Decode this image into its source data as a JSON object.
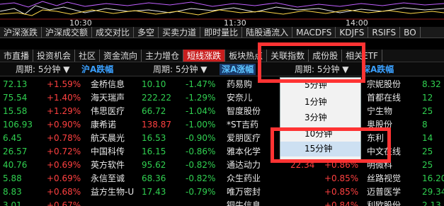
{
  "time_axis": [
    "10:30",
    "11:30",
    "14:00"
  ],
  "tabs_row1": [
    "沪深涨跌",
    "沪深成交额",
    "成交对比",
    "多空",
    "买卖力道",
    "即时量比",
    "陆股通流入",
    "MACDFS",
    "KDJFS",
    "RSIFS",
    "BO"
  ],
  "tabs_row2": [
    "市直播",
    "投资机会",
    "社区",
    "资金流向",
    "主力增仓",
    "短线涨跌",
    "板块热点",
    "关联指数",
    "成份股",
    "相关ETF"
  ],
  "active_tab_row2": "短线涨跌",
  "section_header": {
    "period_left": "周期: 5分钟 ▼",
    "title_left": "沪A跌幅",
    "period_mid": "周期: 5分钟 ▼",
    "title_mid": "深A涨幅",
    "period_right": "周期: 5分钟 ▼",
    "title_right": "深A跌幅"
  },
  "left_panel": [
    {
      "price": "72.13",
      "pct": "+1.59%"
    },
    {
      "price": "75.54",
      "pct": "+1.40%"
    },
    {
      "price": "15.58",
      "pct": "+1.29%"
    },
    {
      "price": "106.93",
      "pct": "+0.90%"
    },
    {
      "price": "6.45",
      "pct": "+0.78%"
    },
    {
      "price": "26.57",
      "pct": "+0.72%"
    },
    {
      "price": "40.76",
      "pct": "+0.69%"
    },
    {
      "price": "5.88",
      "pct": "+0.69%"
    },
    {
      "price": "8.83",
      "pct": "+0.68%"
    },
    {
      "price": "3.01",
      "pct": "+0.67%"
    }
  ],
  "mid_panel": [
    {
      "name": "金桥信息",
      "price": "10.10",
      "pct": "-1.47%"
    },
    {
      "name": "海天瑞声",
      "price": "222.22",
      "pct": "-1.29%"
    },
    {
      "name": "伟思医疗",
      "price": "66.72",
      "pct": "-1.04%"
    },
    {
      "name": "康希诺",
      "price": "138.87",
      "pct": "-1.00%"
    },
    {
      "name": "航天晨光",
      "price": "16.53",
      "pct": "-0.90%"
    },
    {
      "name": "中国科传",
      "price": "16.15",
      "pct": "-0.86%"
    },
    {
      "name": "英方软件",
      "price": "95.62",
      "pct": "-0.82%"
    },
    {
      "name": "永信至诚",
      "price": "68.36",
      "pct": "-0.82%"
    },
    {
      "name": "益方生物-U",
      "price": "17.43",
      "pct": "-0.79%"
    }
  ],
  "right_stock_names": [
    "药易购",
    "安奈儿",
    "智度股份",
    "*ST吉药",
    "爱朋医疗",
    "雅本化学",
    "通达动力",
    "众生药业",
    "唯万密封",
    "铜牛信息"
  ],
  "right_partial_values": [
    {
      "price": "22.34",
      "pct": "+0.86%"
    },
    {
      "price": "",
      "pct": "+0.85%"
    },
    {
      "price": "",
      "pct": "+0.85%"
    },
    {
      "price": "",
      "pct": "+0.84%"
    }
  ],
  "far_right": [
    {
      "name": "宗妮股份",
      "price": "8.32"
    },
    {
      "name": "首都在线",
      "price": "12"
    },
    {
      "name": "宁生物",
      "price": "25"
    },
    {
      "name": "奥股份",
      "price": "8"
    },
    {
      "name": "东利",
      "price": "14"
    },
    {
      "name": "中文在线",
      "price": "25"
    },
    {
      "name": "明微科",
      "price": "25"
    },
    {
      "name": "丝路视觉",
      "price": "16.20"
    },
    {
      "name": "迈普医学",
      "price": "29.34"
    },
    {
      "name": "利欧股份",
      "price": "2.13"
    }
  ],
  "dropdown": {
    "items": [
      "5分钟",
      "1分钟",
      "3分钟",
      "10分钟",
      "15分钟"
    ],
    "selected": "15分钟"
  },
  "colors": {
    "up": "#ff4040",
    "down": "#30d050",
    "active_tab": "#c81e1e",
    "annotation": "#ff3333",
    "selected_item": "#cde0f2"
  }
}
